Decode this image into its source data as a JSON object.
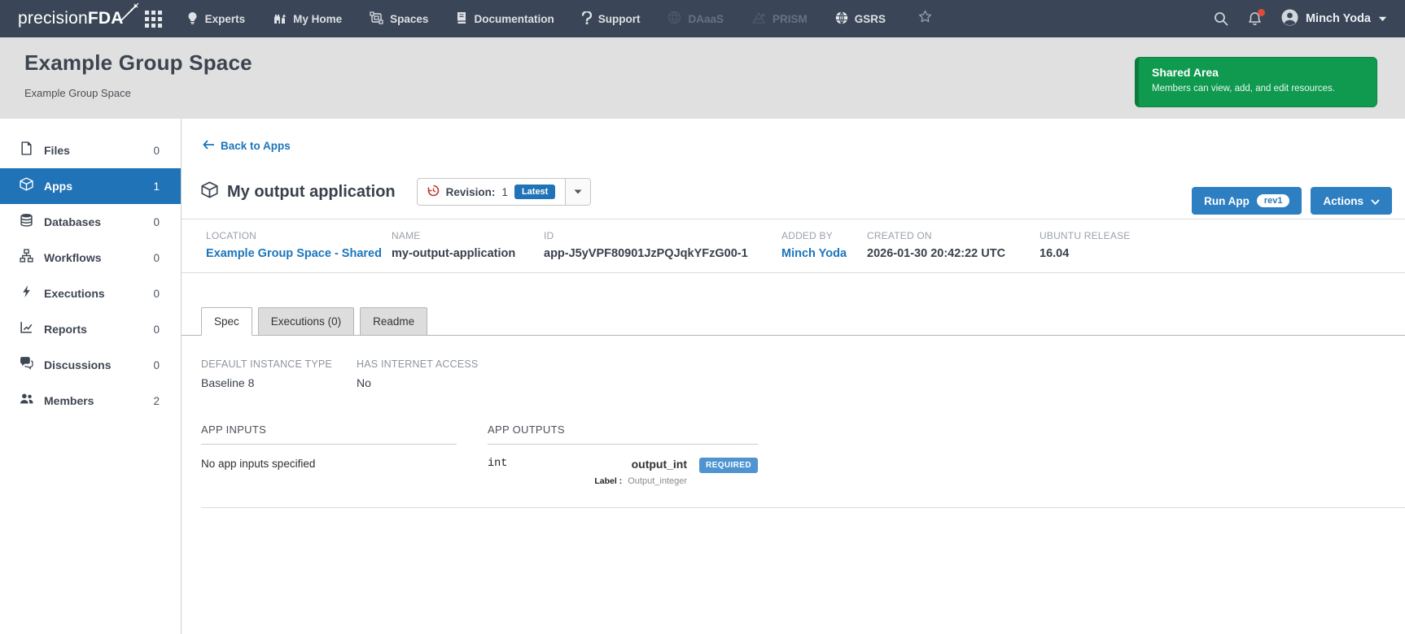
{
  "navbar": {
    "brand_prefix": "precision",
    "brand_suffix": "FDA",
    "items": [
      {
        "label": "Experts",
        "icon": "lightbulb-icon",
        "disabled": false
      },
      {
        "label": "My Home",
        "icon": "home-icon",
        "disabled": false
      },
      {
        "label": "Spaces",
        "icon": "spaces-icon",
        "disabled": false
      },
      {
        "label": "Documentation",
        "icon": "book-icon",
        "disabled": false
      },
      {
        "label": "Support",
        "icon": "question-icon",
        "disabled": false
      },
      {
        "label": "DAaaS",
        "icon": "daaas-icon",
        "disabled": true
      },
      {
        "label": "PRISM",
        "icon": "prism-icon",
        "disabled": true
      },
      {
        "label": "GSRS",
        "icon": "globe-icon",
        "disabled": false
      }
    ],
    "user_name": "Minch Yoda",
    "has_notification": true
  },
  "header": {
    "title": "Example Group Space",
    "subtitle": "Example Group Space",
    "shared_area": {
      "title": "Shared Area",
      "description": "Members can view, add, and edit resources.",
      "color": "#109a4f"
    }
  },
  "sidebar": {
    "items": [
      {
        "label": "Files",
        "count": "0",
        "icon": "file-icon",
        "active": false
      },
      {
        "label": "Apps",
        "count": "1",
        "icon": "cube-icon",
        "active": true
      },
      {
        "label": "Databases",
        "count": "0",
        "icon": "database-icon",
        "active": false
      },
      {
        "label": "Workflows",
        "count": "0",
        "icon": "workflow-icon",
        "active": false
      },
      {
        "label": "Executions",
        "count": "0",
        "icon": "bolt-icon",
        "active": false
      },
      {
        "label": "Reports",
        "count": "0",
        "icon": "report-icon",
        "active": false
      },
      {
        "label": "Discussions",
        "count": "0",
        "icon": "discussions-icon",
        "active": false
      },
      {
        "label": "Members",
        "count": "2",
        "icon": "members-icon",
        "active": false
      }
    ]
  },
  "main": {
    "back_link": "Back to Apps",
    "app": {
      "title": "My output application",
      "revision_label": "Revision:",
      "revision_number": "1",
      "revision_badge": "Latest"
    },
    "cta": {
      "run_app": "Run App",
      "run_app_badge": "rev1",
      "actions": "Actions"
    },
    "metadata": [
      {
        "label": "LOCATION",
        "value": "Example Group Space - Shared"
      },
      {
        "label": "NAME",
        "value": "my-output-application"
      },
      {
        "label": "ID",
        "value": "app-J5yVPF80901JzPQJqkYFzG00-1"
      },
      {
        "label": "ADDED BY",
        "value": "Minch Yoda"
      },
      {
        "label": "CREATED ON",
        "value": "2026-01-30 20:42:22 UTC"
      },
      {
        "label": "UBUNTU RELEASE",
        "value": "16.04"
      }
    ],
    "tabs": [
      {
        "label": "Spec"
      },
      {
        "label": "Executions (0)"
      },
      {
        "label": "Readme"
      }
    ],
    "spec": {
      "instance_label": "DEFAULT INSTANCE TYPE",
      "instance_value": "Baseline 8",
      "internet_label": "HAS INTERNET ACCESS",
      "internet_value": "No",
      "inputs_title": "APP INPUTS",
      "inputs_empty": "No app inputs specified",
      "outputs_title": "APP OUTPUTS",
      "output": {
        "type": "int",
        "name": "output_int",
        "required_badge": "REQUIRED",
        "label_key": "Label :",
        "label_value": "Output_integer"
      }
    }
  },
  "accent_colors": {
    "navbar_bg": "#3a4657",
    "active_blue": "#2173b8",
    "button_blue": "#2d7fc1",
    "link_blue": "#1b75bb",
    "shared_green": "#109a4f",
    "required_badge_blue": "#4d94d0",
    "notification_red": "#e0493f"
  }
}
